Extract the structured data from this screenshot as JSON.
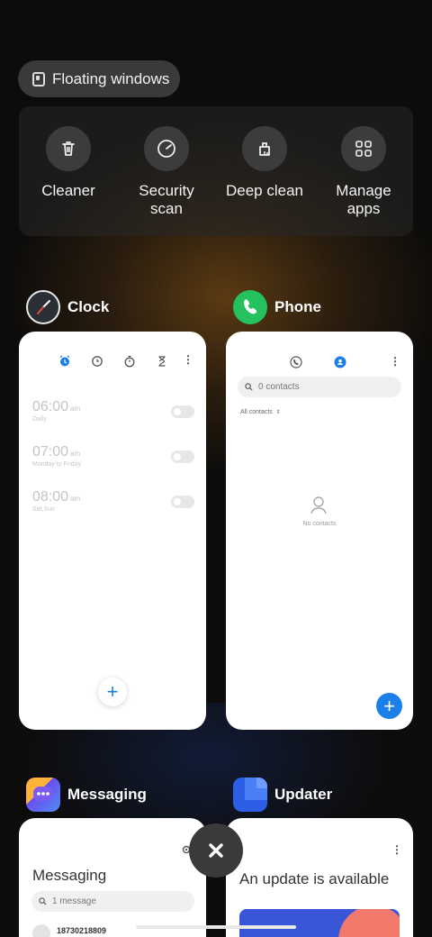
{
  "floating_windows": {
    "label": "Floating windows"
  },
  "tools": [
    {
      "label": "Cleaner",
      "icon": "trash-icon"
    },
    {
      "label": "Security scan",
      "icon": "shield-scan-icon"
    },
    {
      "label": "Deep clean",
      "icon": "deep-clean-icon"
    },
    {
      "label": "Manage apps",
      "icon": "grid-apps-icon"
    }
  ],
  "apps": {
    "clock": {
      "name": "Clock",
      "alarms": [
        {
          "time": "06:00",
          "ampm": "am",
          "repeat": "Daily"
        },
        {
          "time": "07:00",
          "ampm": "am",
          "repeat": "Monday to Friday"
        },
        {
          "time": "08:00",
          "ampm": "am",
          "repeat": "Sat,Sun"
        }
      ]
    },
    "phone": {
      "name": "Phone",
      "search_placeholder": "0 contacts",
      "filter": "All contacts",
      "empty": "No contacts"
    },
    "messaging": {
      "name": "Messaging",
      "title": "Messaging",
      "search_placeholder": "1 message",
      "first_sender": "18730218809"
    },
    "updater": {
      "name": "Updater",
      "headline": "An update is available"
    }
  },
  "colors": {
    "accent_blue": "#1a7fe8",
    "phone_green": "#25c15e",
    "messaging_purple": "#6a4ef0",
    "updater_blue": "#3a6ff0"
  }
}
